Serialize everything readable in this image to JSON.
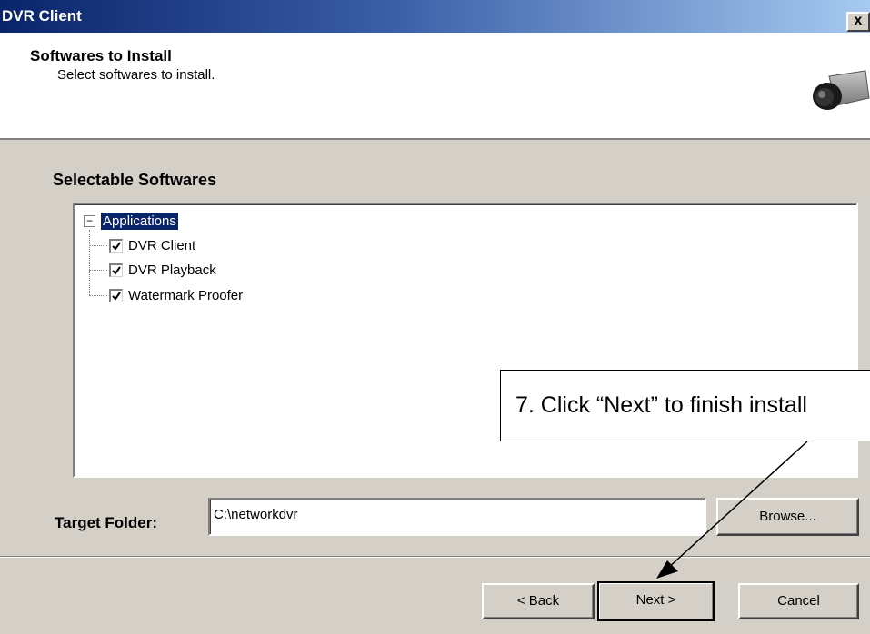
{
  "window": {
    "title": "DVR Client",
    "close_glyph": "x",
    "close_icon": "close-icon"
  },
  "header": {
    "title": "Softwares to Install",
    "subtitle": "Select softwares to install.",
    "icon": "camera-icon"
  },
  "selectable": {
    "heading": "Selectable Softwares",
    "root": {
      "label": "Applications",
      "expander": "−",
      "expanded": true,
      "selected": true
    },
    "items": [
      {
        "label": "DVR Client",
        "checked": true
      },
      {
        "label": "DVR Playback",
        "checked": true
      },
      {
        "label": "Watermark Proofer",
        "checked": true
      }
    ]
  },
  "target": {
    "label": "Target Folder:",
    "value": "C:\\networkdvr",
    "browse_label": "Browse..."
  },
  "buttons": {
    "back": "< Back",
    "next": "Next >",
    "cancel": "Cancel"
  },
  "annotation": {
    "text": "7. Click “Next” to finish install"
  },
  "colors": {
    "titlebar_start": "#0a246a",
    "titlebar_end": "#a6caf0",
    "selection": "#0a246a",
    "face": "#d4d0c8"
  }
}
